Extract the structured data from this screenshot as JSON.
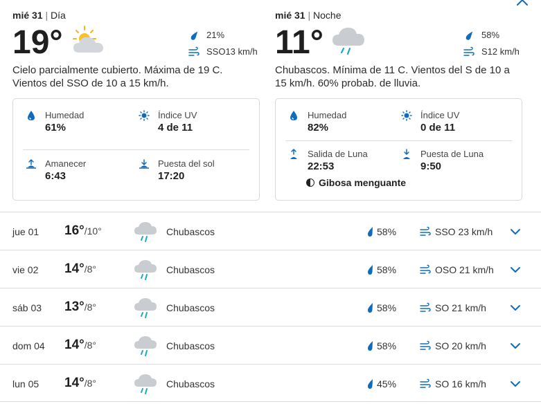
{
  "colors": {
    "accent": "#0f6cbd",
    "text": "#252525",
    "border": "#d8d8d8"
  },
  "day": {
    "date": "mié 31",
    "separator": "|",
    "period": "Día",
    "temp": "19°",
    "icon": "partly-cloudy-icon",
    "precip": "21%",
    "wind": "SSO13 km/h",
    "description": "Cielo parcialmente cubierto. Máxima de 19 C. Vientos del SSO de 10 a 15 km/h.",
    "details": {
      "humidity_label": "Humedad",
      "humidity_value": "61%",
      "uv_label": "Índice UV",
      "uv_value": "4 de 11",
      "sunrise_label": "Amanecer",
      "sunrise_value": "6:43",
      "sunset_label": "Puesta del sol",
      "sunset_value": "17:20"
    }
  },
  "night": {
    "date": "mié 31",
    "separator": "|",
    "period": "Noche",
    "temp": "11°",
    "icon": "rain-showers-icon",
    "precip": "58%",
    "wind": "S12 km/h",
    "description": "Chubascos. Mínima de 11 C. Vientos del S de 10 a 15 km/h. 60% probab. de lluvia.",
    "details": {
      "humidity_label": "Humedad",
      "humidity_value": "82%",
      "uv_label": "Índice UV",
      "uv_value": "0 de 11",
      "moonrise_label": "Salida de Luna",
      "moonrise_value": "22:53",
      "moonset_label": "Puesta de Luna",
      "moonset_value": "9:50",
      "moon_phase": "Gibosa menguante"
    }
  },
  "forecast": [
    {
      "date": "jue 01",
      "high": "16°",
      "low": "/10°",
      "condition": "Chubascos",
      "precip": "58%",
      "wind": "SSO 23 km/h"
    },
    {
      "date": "vie 02",
      "high": "14°",
      "low": "/8°",
      "condition": "Chubascos",
      "precip": "58%",
      "wind": "OSO 21 km/h"
    },
    {
      "date": "sáb 03",
      "high": "13°",
      "low": "/8°",
      "condition": "Chubascos",
      "precip": "58%",
      "wind": "SO 21 km/h"
    },
    {
      "date": "dom 04",
      "high": "14°",
      "low": "/8°",
      "condition": "Chubascos",
      "precip": "58%",
      "wind": "SO 20 km/h"
    },
    {
      "date": "lun 05",
      "high": "14°",
      "low": "/8°",
      "condition": "Chubascos",
      "precip": "45%",
      "wind": "SO 16 km/h"
    }
  ]
}
